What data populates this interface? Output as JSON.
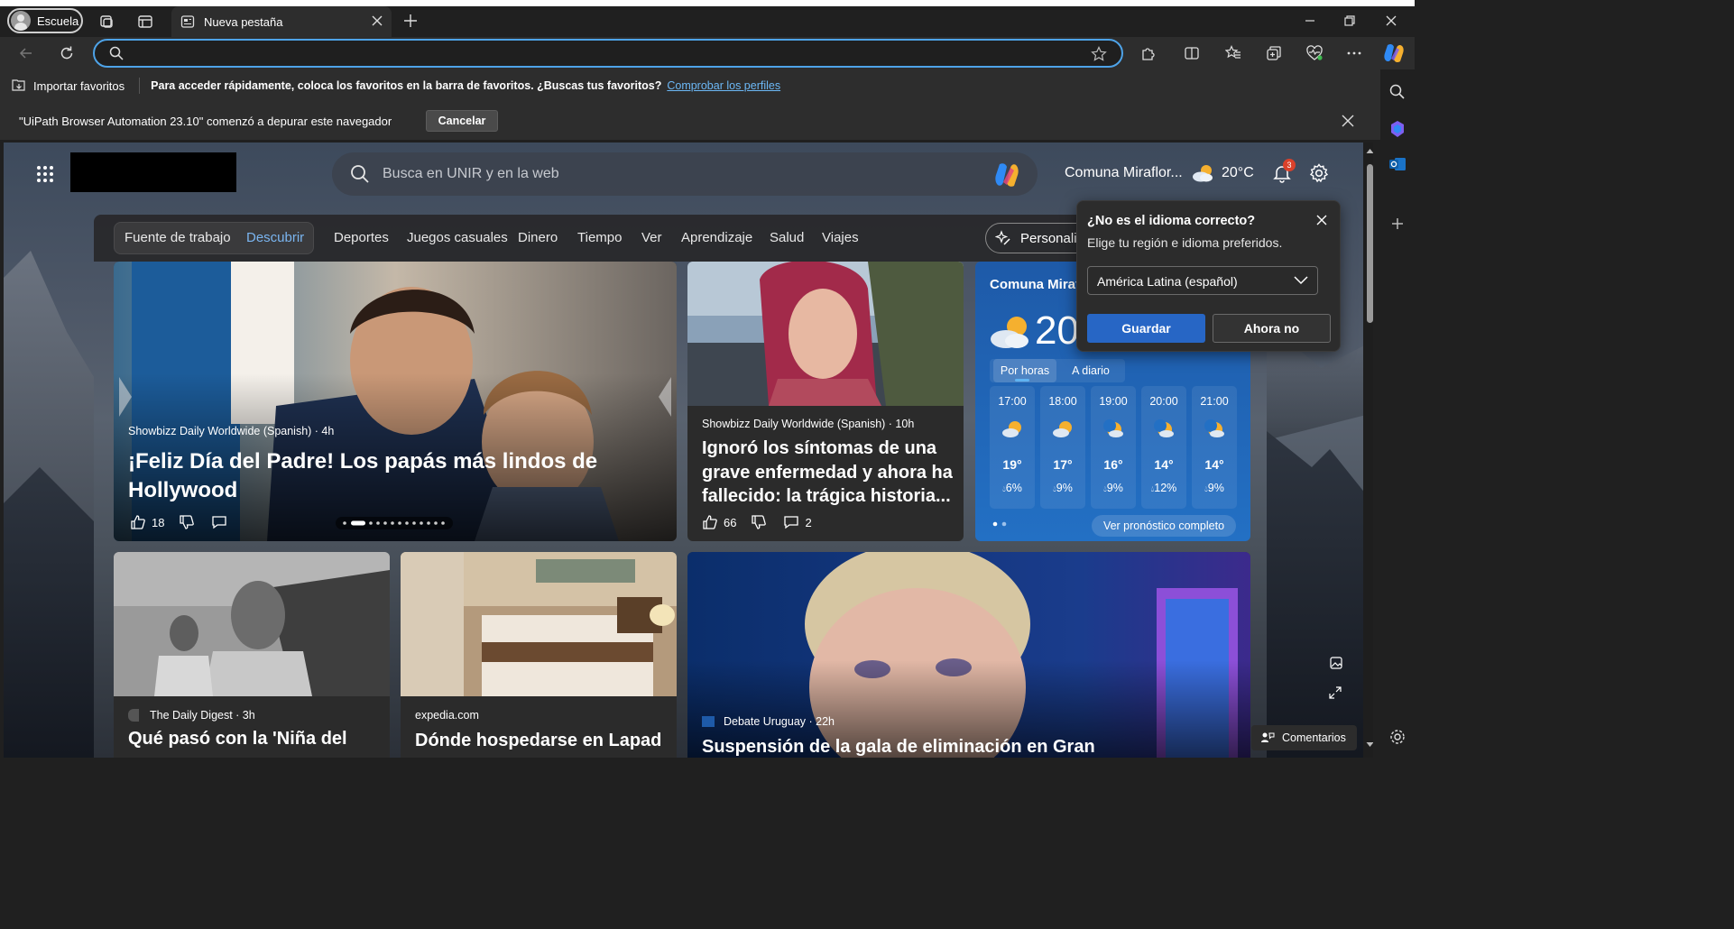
{
  "browser": {
    "profile_name": "Escuela",
    "tab_title": "Nueva pestaña",
    "address_value": ""
  },
  "favorites_bar": {
    "import_label": "Importar favoritos",
    "message": "Para acceder rápidamente, coloca los favoritos en la barra de favoritos. ¿Buscas tus favoritos?",
    "link": "Comprobar los perfiles"
  },
  "infobar": {
    "message": "\"UiPath Browser Automation 23.10\" comenzó a depurar este navegador",
    "cancel_label": "Cancelar"
  },
  "page": {
    "search_placeholder": "Busca en UNIR y en la web",
    "location": "Comuna Miraflor...",
    "temperature": "20°C",
    "notification_count": "3",
    "nav": {
      "pill_items": [
        "Fuente de trabajo",
        "Descubrir"
      ],
      "items": [
        "Deportes",
        "Juegos casuales",
        "Dinero",
        "Tiempo",
        "Ver",
        "Aprendizaje",
        "Salud",
        "Viajes"
      ],
      "personalize": "Personaliz"
    }
  },
  "cards": {
    "main": {
      "source": "Showbizz Daily Worldwide (Spanish) · 4h",
      "title": "¡Feliz Día del Padre! Los papás más lindos de Hollywood",
      "likes": "18"
    },
    "second": {
      "source": "Showbizz Daily Worldwide (Spanish) · 10h",
      "title": "Ignoró los síntomas de una grave enfermedad y ahora ha fallecido: la trágica historia...",
      "likes": "66",
      "comments": "2"
    },
    "third": {
      "source": "The Daily Digest · 3h",
      "title": "Qué pasó con la 'Niña del"
    },
    "fourth": {
      "source": "expedia.com",
      "title": "Dónde hospedarse en Lapad"
    },
    "fifth": {
      "source": "Debate Uruguay · 22h",
      "title": "Suspensión de la gala de eliminación en Gran"
    }
  },
  "weather": {
    "location": "Comuna Miraf",
    "temp_big": "20",
    "tab_hourly": "Por horas",
    "tab_daily": "A diario",
    "hours": [
      {
        "time": "17:00",
        "temp": "19°",
        "rain": "6%",
        "icon": "partly-cloudy-icon"
      },
      {
        "time": "18:00",
        "temp": "17°",
        "rain": "9%",
        "icon": "partly-cloudy-icon"
      },
      {
        "time": "19:00",
        "temp": "16°",
        "rain": "9%",
        "icon": "moon-icon"
      },
      {
        "time": "20:00",
        "temp": "14°",
        "rain": "12%",
        "icon": "moon-icon"
      },
      {
        "time": "21:00",
        "temp": "14°",
        "rain": "9%",
        "icon": "moon-icon"
      }
    ],
    "forecast_link": "Ver pronóstico completo"
  },
  "language_popup": {
    "question": "¿No es el idioma correcto?",
    "subtitle": "Elige tu región e idioma preferidos.",
    "selected": "América Latina (español)",
    "save": "Guardar",
    "decline": "Ahora no"
  },
  "feedback": "Comentarios",
  "colors": {
    "accent": "#2766c5",
    "address_border": "#4ea3e8",
    "link": "#6cb8f6",
    "weather_card": "#2370c4",
    "badge": "#d9412b"
  }
}
